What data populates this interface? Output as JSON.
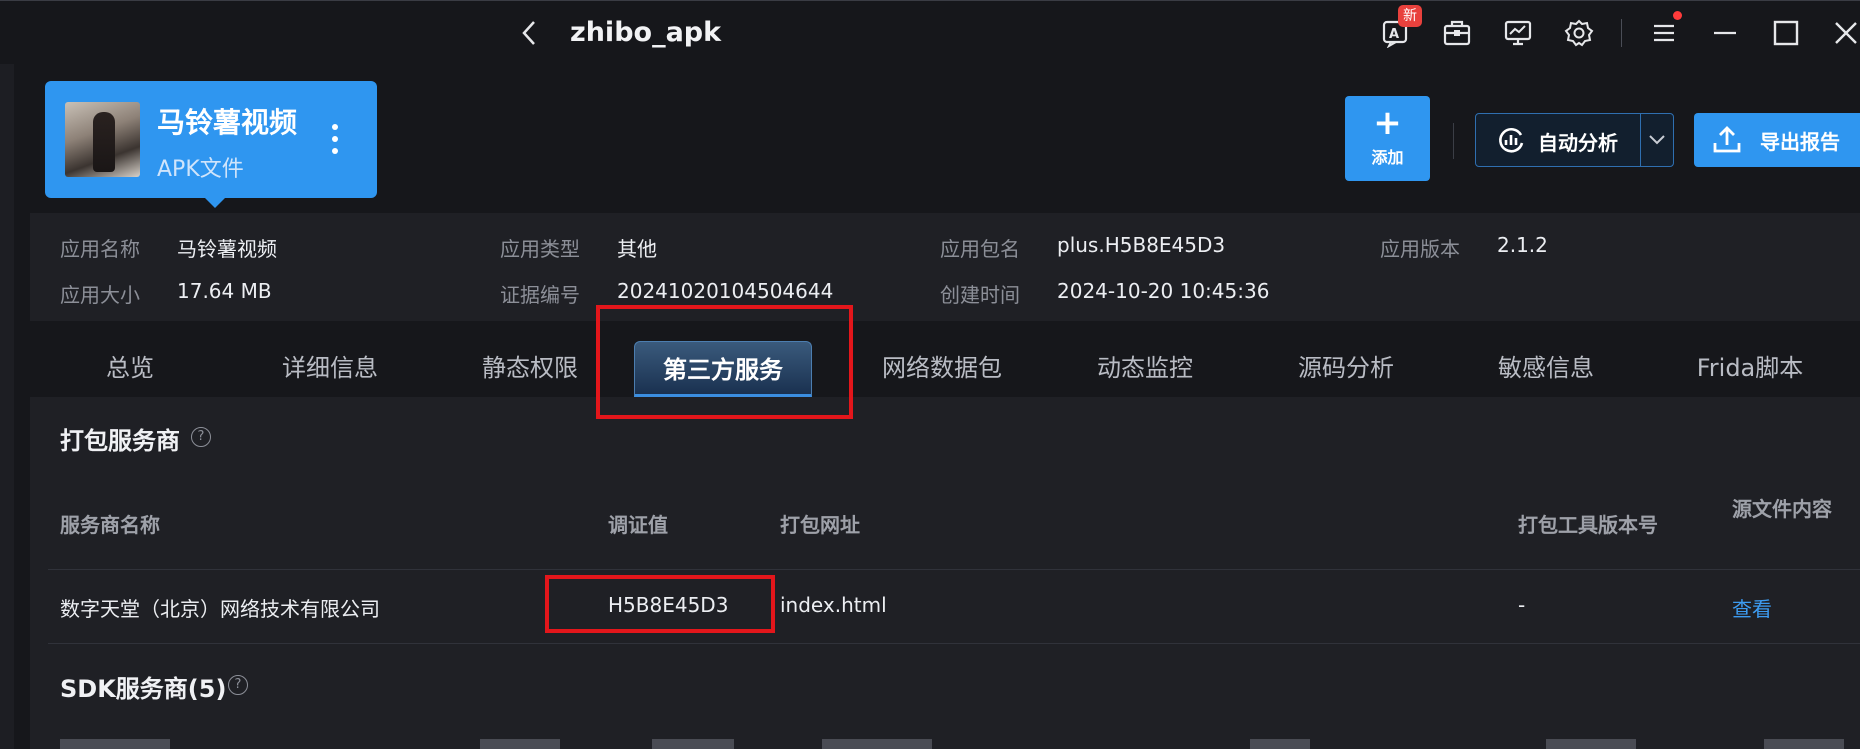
{
  "titlebar": {
    "title": "zhibo_apk",
    "new_badge": "新",
    "icons": [
      "ai-assistant-icon",
      "toolbox-icon",
      "monitor-icon",
      "settings-icon",
      "menu-icon",
      "minimize-icon",
      "maximize-icon",
      "close-icon"
    ]
  },
  "app_card": {
    "name": "马铃薯视频",
    "type": "APK文件"
  },
  "actions": {
    "add_label": "添加",
    "add_symbol": "+",
    "auto_analyze_label": "自动分析",
    "export_label": "导出报告"
  },
  "info": {
    "app_name_label": "应用名称",
    "app_name_value": "马铃薯视频",
    "app_type_label": "应用类型",
    "app_type_value": "其他",
    "package_label": "应用包名",
    "package_value": "plus.H5B8E45D3",
    "version_label": "应用版本",
    "version_value": "2.1.2",
    "size_label": "应用大小",
    "size_value": "17.64 MB",
    "evidence_label": "证据编号",
    "evidence_value": "20241020104504644",
    "created_label": "创建时间",
    "created_value": "2024-10-20 10:45:36"
  },
  "tabs": [
    "总览",
    "详细信息",
    "静态权限",
    "第三方服务",
    "网络数据包",
    "动态监控",
    "源码分析",
    "敏感信息",
    "Frida脚本"
  ],
  "active_tab": "第三方服务",
  "packaging": {
    "title": "打包服务商",
    "help": "?",
    "columns": [
      "服务商名称",
      "调证值",
      "打包网址",
      "打包工具版本号",
      "源文件内容"
    ],
    "rows": [
      {
        "provider": "数字天堂（北京）网络技术有限公司",
        "evidence": "H5B8E45D3",
        "url": "index.html",
        "tool_version": "-",
        "source": "查看"
      }
    ]
  },
  "sdk": {
    "title": "SDK服务商(5)",
    "help": "?"
  },
  "colors": {
    "accent": "#2f96f0",
    "highlight": "#e3161b",
    "link": "#3d9bf0"
  }
}
